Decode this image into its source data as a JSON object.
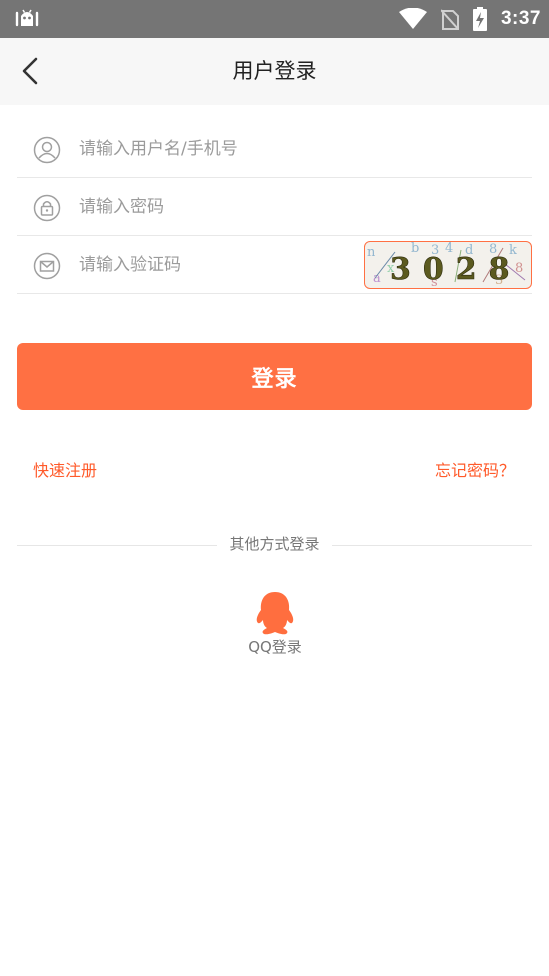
{
  "status_bar": {
    "time": "3:37",
    "icons": [
      "android-debug-icon",
      "wifi-icon",
      "no-sim-icon",
      "battery-charging-icon"
    ]
  },
  "header": {
    "title": "用户登录",
    "back_icon": "chevron-left-icon"
  },
  "form": {
    "username": {
      "placeholder": "请输入用户名/手机号",
      "value": "",
      "icon": "user-icon"
    },
    "password": {
      "placeholder": "请输入密码",
      "value": "",
      "icon": "lock-icon"
    },
    "captcha": {
      "placeholder": "请输入验证码",
      "value": "",
      "icon": "envelope-icon",
      "image_text": "3028"
    }
  },
  "login_button": {
    "label": "登录"
  },
  "links": {
    "register": "快速注册",
    "forgot_password": "忘记密码？"
  },
  "other_login": {
    "title": "其他方式登录",
    "qq_label": "QQ登录",
    "qq_icon": "qq-penguin-icon"
  },
  "colors": {
    "accent": "#ff7043",
    "status_bar": "#757575",
    "header_bg": "#f7f7f7",
    "link": "#ff5a2a"
  }
}
